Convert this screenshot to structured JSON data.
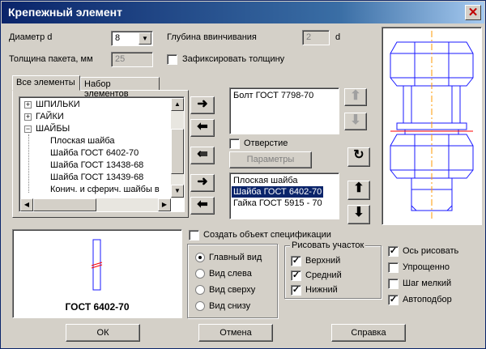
{
  "window": {
    "title": "Крепежный элемент",
    "close_symbol": "✕"
  },
  "params": {
    "diameter_label": "Диаметр d",
    "diameter_value": "8",
    "depth_label": "Глубина ввинчивания",
    "depth_value": "2",
    "depth_unit": "d",
    "thickness_label": "Толщина пакета, мм",
    "thickness_value": "25",
    "fix_thickness_label": "Зафиксировать толщину"
  },
  "tabs": [
    {
      "label": "Все элементы",
      "active": true
    },
    {
      "label": "Набор элементов",
      "active": false
    }
  ],
  "tree": {
    "groups": [
      "ШПИЛЬКИ",
      "ГАЙКИ",
      "ШАЙБЫ"
    ],
    "children": [
      "Плоская шайба",
      "Шайба ГОСТ 6402-70",
      "Шайба ГОСТ 13438-68",
      "Шайба ГОСТ 13439-68",
      "Конич. и сферич. шайбы в сбо"
    ]
  },
  "arrows": {
    "right": "➜",
    "left": "⬅",
    "double_left": "⇚",
    "up": "⬆",
    "down": "⬇",
    "refresh": "↻"
  },
  "bolt_list": [
    "Болт ГОСТ 7798-70"
  ],
  "hole_label": "Отверстие",
  "params_button": "Параметры",
  "set_list": [
    "Плоская шайба",
    "Шайба ГОСТ 6402-70",
    "Гайка ГОСТ 5915 - 70"
  ],
  "set_selected_index": 1,
  "create_spec_label": "Создать объект спецификации",
  "preview_caption": "ГОСТ 6402-70",
  "views": [
    "Главный вид",
    "Вид слева",
    "Вид сверху",
    "Вид снизу"
  ],
  "selected_view": 0,
  "draw_section": {
    "title": "Рисовать участок",
    "items": [
      {
        "label": "Верхний",
        "checked": true
      },
      {
        "label": "Средний",
        "checked": true
      },
      {
        "label": "Нижний",
        "checked": true
      }
    ]
  },
  "options": [
    {
      "label": "Ось рисовать",
      "checked": true
    },
    {
      "label": "Упрощенно",
      "checked": false
    },
    {
      "label": "Шаг мелкий",
      "checked": false
    },
    {
      "label": "Автоподбор",
      "checked": true
    }
  ],
  "buttons": {
    "ok": "ОК",
    "cancel": "Отмена",
    "help": "Справка"
  },
  "check_mark": "✓",
  "tree_plus": "+",
  "tree_minus": "−",
  "combo_arrow": "▼",
  "colors": {
    "title_start": "#0a246a",
    "selection": "#0a246a",
    "drawing": "#1a1aff",
    "axis": "#ff9900",
    "section": "#ff0000"
  }
}
